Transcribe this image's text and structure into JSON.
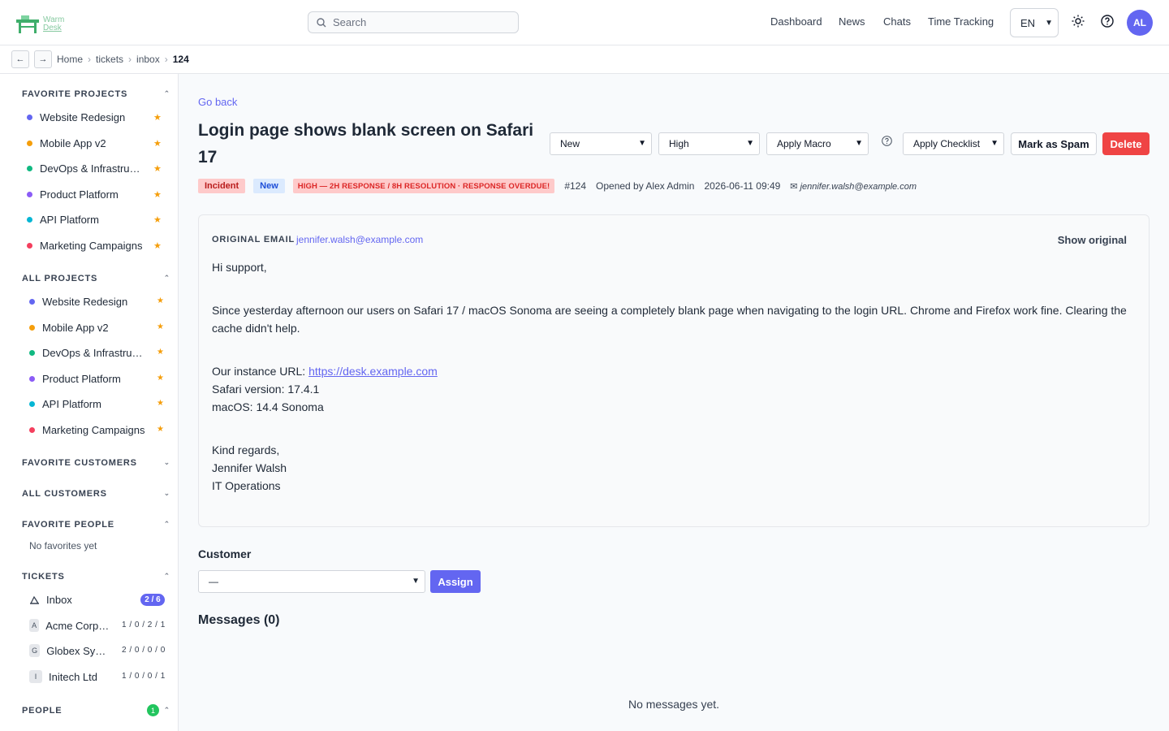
{
  "app": {
    "logo_line1": "Warm",
    "logo_line2": "Desk"
  },
  "search": {
    "placeholder": "Search"
  },
  "nav": {
    "dashboard": "Dashboard",
    "news": "News",
    "chats": "Chats",
    "time_tracking": "Time Tracking",
    "language": "EN",
    "avatar_initials": "AL"
  },
  "breadcrumb": {
    "back": "←",
    "forward": "→",
    "items": [
      "Home",
      "tickets",
      "inbox"
    ],
    "current": "124",
    "sep": "›"
  },
  "sidebar": {
    "favorite_projects": {
      "title": "FAVORITE PROJECTS",
      "items": [
        {
          "label": "Website Redesign",
          "color": "#6366f1"
        },
        {
          "label": "Mobile App v2",
          "color": "#f59e0b"
        },
        {
          "label": "DevOps & Infrastructure",
          "color": "#10b981"
        },
        {
          "label": "Product Platform",
          "color": "#8b5cf6"
        },
        {
          "label": "API Platform",
          "color": "#06b6d4"
        },
        {
          "label": "Marketing Campaigns",
          "color": "#f43f5e"
        }
      ]
    },
    "all_projects": {
      "title": "ALL PROJECTS",
      "items": [
        {
          "label": "Website Redesign",
          "color": "#6366f1"
        },
        {
          "label": "Mobile App v2",
          "color": "#f59e0b"
        },
        {
          "label": "DevOps & Infrastructure",
          "color": "#10b981"
        },
        {
          "label": "Product Platform",
          "color": "#8b5cf6"
        },
        {
          "label": "API Platform",
          "color": "#06b6d4"
        },
        {
          "label": "Marketing Campaigns",
          "color": "#f43f5e"
        }
      ]
    },
    "favorite_customers": {
      "title": "FAVORITE CUSTOMERS"
    },
    "all_customers": {
      "title": "ALL CUSTOMERS"
    },
    "favorite_people": {
      "title": "FAVORITE PEOPLE",
      "empty": "No favorites yet"
    },
    "tickets": {
      "title": "TICKETS",
      "inbox_label": "Inbox",
      "inbox_count": "2 / 6",
      "customers": [
        {
          "initial": "A",
          "label": "Acme Corporation",
          "counts": "1 / 0 / 2 / 1"
        },
        {
          "initial": "G",
          "label": "Globex Systems",
          "counts": "2 / 0 / 0 / 0"
        },
        {
          "initial": "I",
          "label": "Initech Ltd",
          "counts": "1 / 0 / 0 / 1"
        }
      ]
    },
    "people": {
      "title": "PEOPLE",
      "count": "1"
    }
  },
  "ticket": {
    "go_back": "Go back",
    "title": "Login page shows blank screen on Safari 17",
    "status": "New",
    "priority": "High",
    "macro": "Apply Macro",
    "checklist": "Apply Checklist",
    "spam": "Mark as Spam",
    "delete": "Delete",
    "type_tag": "Incident",
    "status_tag": "New",
    "sla_tag": "HIGH — 2H RESPONSE / 8H RESOLUTION · RESPONSE OVERDUE!",
    "number": "#124",
    "opened_by": "Opened by Alex Admin",
    "opened_at": "2026-06-11 09:49",
    "reporter_email": "✉ jennifer.walsh@example.com"
  },
  "email": {
    "heading": "ORIGINAL EMAIL",
    "from": "jennifer.walsh@example.com",
    "show_original": "Show original",
    "greeting": "Hi support,",
    "paragraph": "Since yesterday afternoon our users on Safari 17 / macOS Sonoma are seeing a completely blank page when navigating to the login URL. Chrome and Firefox work fine. Clearing the cache didn't help.",
    "instance_prefix": "Our instance URL: ",
    "instance_url": "https://desk.example.com",
    "safari_version": "Safari version: 17.4.1",
    "macos": "macOS: 14.4 Sonoma",
    "regards": "Kind regards,",
    "name": "Jennifer Walsh",
    "dept": "IT Operations"
  },
  "customer": {
    "label": "Customer",
    "selected": "—",
    "assign": "Assign"
  },
  "messages": {
    "title": "Messages (0)",
    "empty": "No messages yet."
  },
  "colors": {
    "accent": "#6366f1",
    "danger": "#ef4444",
    "star": "#f59e0b",
    "success": "#22c55e"
  }
}
